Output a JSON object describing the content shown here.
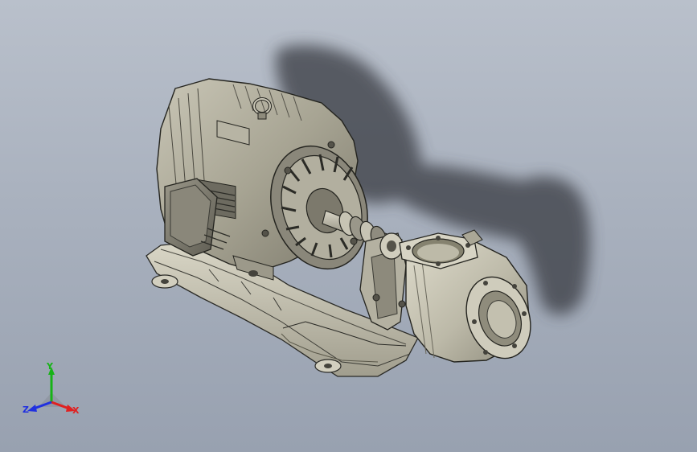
{
  "viewport": {
    "background_top": "#b9c0cb",
    "background_bottom": "#98a1b0"
  },
  "model": {
    "parts": [
      "electric-motor",
      "lifting-eye",
      "terminal-box",
      "nameplate",
      "cooling-fan-guard",
      "shaft",
      "flexible-coupling",
      "bearing-bracket",
      "centrifugal-pump",
      "pump-inlet-flange",
      "pump-outlet-flange",
      "base-frame"
    ],
    "shadow_color": "#3c3f46"
  },
  "triad": {
    "x_label": "X",
    "y_label": "Y",
    "z_label": "Z",
    "x_color": "#e02020",
    "y_color": "#16b316",
    "z_color": "#2030e0"
  }
}
